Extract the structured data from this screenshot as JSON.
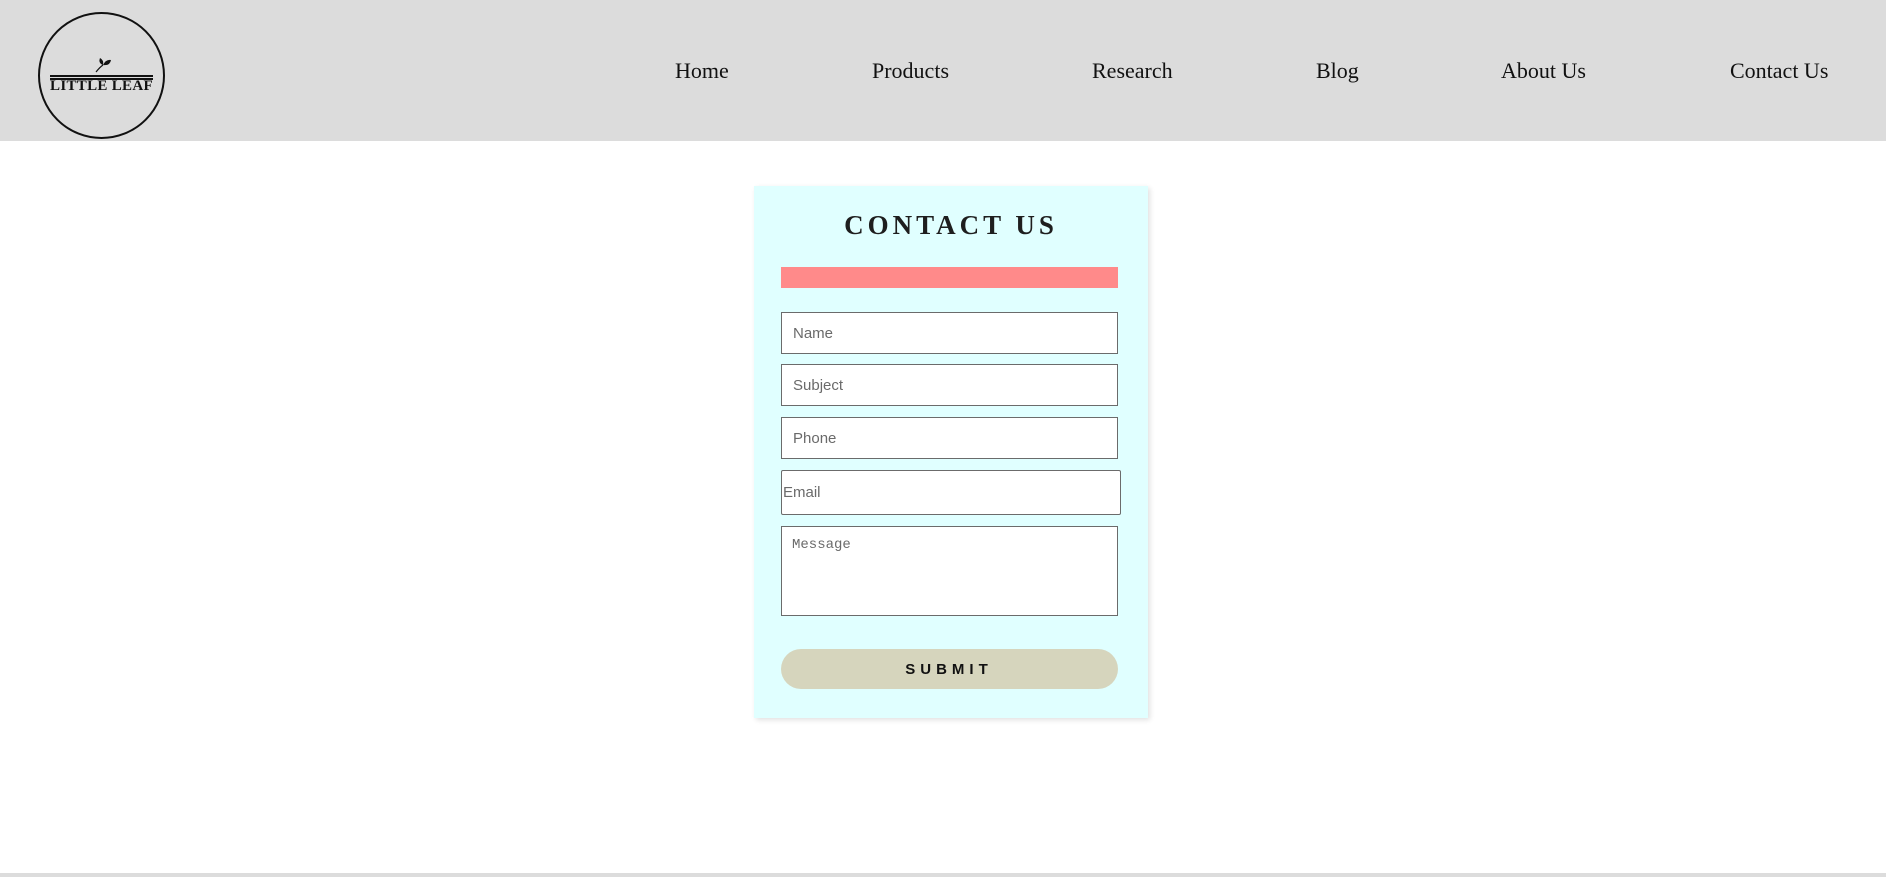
{
  "logo": {
    "text": "LITTLE LEAF",
    "icon": "leaf-icon"
  },
  "nav": {
    "items": [
      {
        "label": "Home"
      },
      {
        "label": "Products"
      },
      {
        "label": "Research"
      },
      {
        "label": "Blog"
      },
      {
        "label": "About Us"
      },
      {
        "label": "Contact Us"
      }
    ]
  },
  "contact_form": {
    "title": "CONTACT US",
    "alert_color": "#ff8a8a",
    "fields": {
      "name": {
        "placeholder": "Name",
        "value": ""
      },
      "subject": {
        "placeholder": "Subject",
        "value": ""
      },
      "phone": {
        "placeholder": "Phone",
        "value": ""
      },
      "email": {
        "placeholder": "Email",
        "value": ""
      },
      "message": {
        "placeholder": "Message",
        "value": ""
      }
    },
    "submit_label": "SUBMIT"
  },
  "colors": {
    "header_bg": "#dcdcdc",
    "card_bg": "#e0ffff",
    "submit_bg": "#d6d5bd"
  }
}
